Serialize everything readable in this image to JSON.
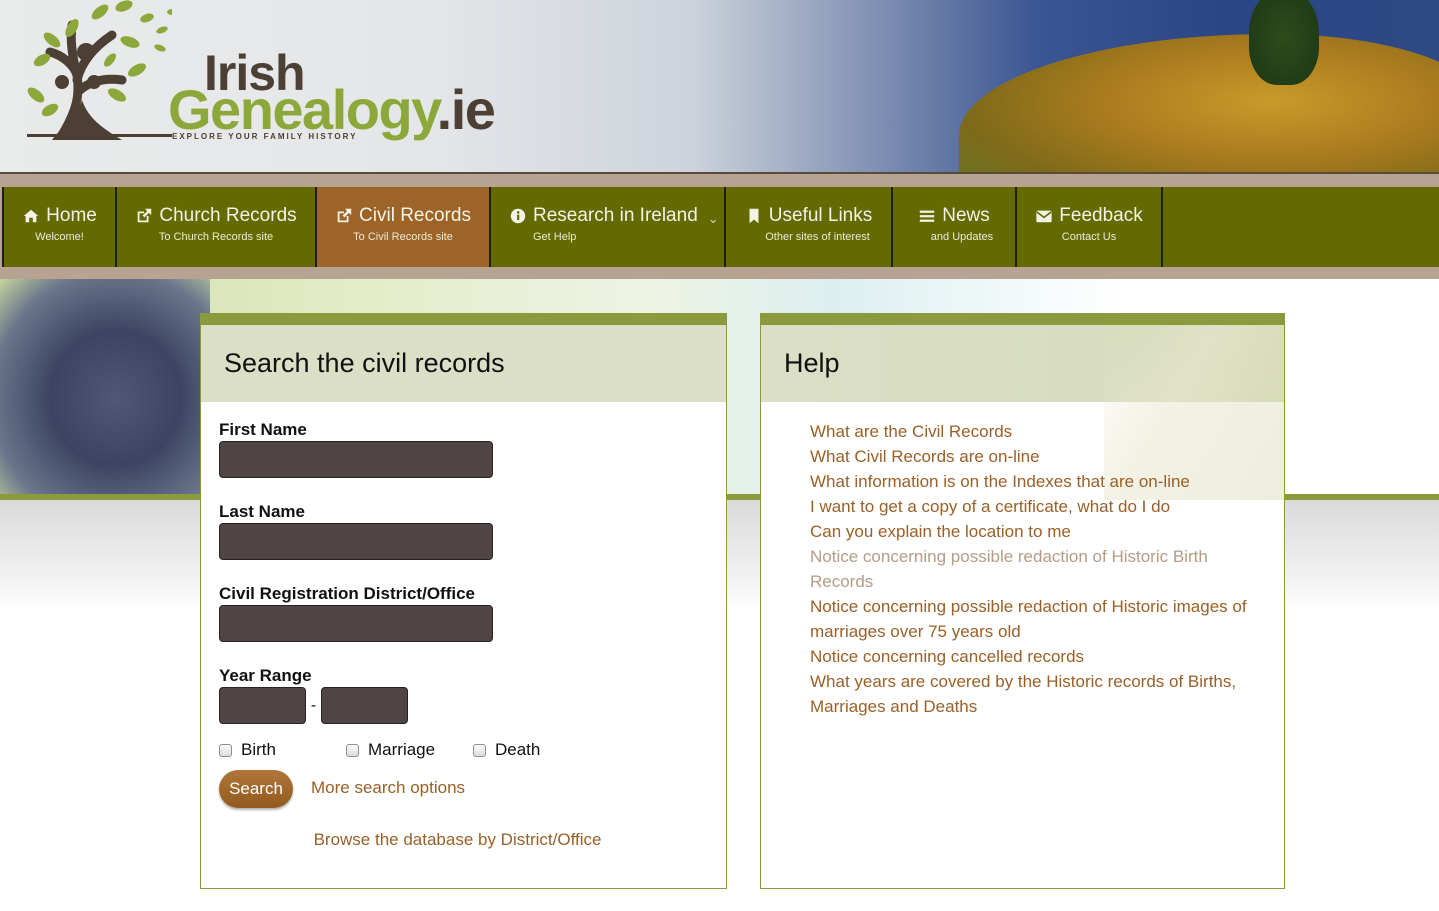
{
  "site": {
    "logo_line1": "Irish",
    "logo_line2": "Genealogy",
    "logo_suffix": ".ie",
    "tagline": "EXPLORE YOUR FAMILY HISTORY"
  },
  "nav": {
    "items": [
      {
        "label": "Home",
        "sub": "Welcome!",
        "icon": "home-icon"
      },
      {
        "label": "Church Records",
        "sub": "To Church Records site",
        "icon": "external-link-icon"
      },
      {
        "label": "Civil Records",
        "sub": "To Civil Records site",
        "icon": "external-link-icon",
        "active": true
      },
      {
        "label": "Research in Ireland",
        "sub": "Get Help",
        "icon": "info-icon",
        "dropdown": "chevron-down-icon"
      },
      {
        "label": "Useful Links",
        "sub": "Other sites of interest",
        "icon": "bookmark-icon"
      },
      {
        "label": "News",
        "sub": "and Updates",
        "icon": "menu-icon"
      },
      {
        "label": "Feedback",
        "sub": "Contact Us",
        "icon": "envelope-icon"
      }
    ],
    "chevron": "⌄"
  },
  "search": {
    "title": "Search the civil records",
    "first_name_label": "First Name",
    "first_name_value": "",
    "last_name_label": "Last Name",
    "last_name_value": "",
    "district_label": "Civil Registration District/Office",
    "district_value": "",
    "year_range_label": "Year Range",
    "year_from_value": "",
    "year_to_value": "",
    "year_separator": "-",
    "checkboxes": [
      {
        "label": "Birth",
        "checked": false
      },
      {
        "label": "Marriage",
        "checked": false
      },
      {
        "label": "Death",
        "checked": false
      }
    ],
    "search_button": "Search",
    "more_options_link": "More search options",
    "browse_link": "Browse the database by District/Office"
  },
  "help": {
    "title": "Help",
    "links": [
      {
        "text": "What are the Civil Records",
        "visited": false
      },
      {
        "text": "What Civil Records are on-line",
        "visited": false
      },
      {
        "text": "What information is on the Indexes that are on-line",
        "visited": false
      },
      {
        "text": "I want to get a copy of a certificate, what do I do",
        "visited": false
      },
      {
        "text": "Can you explain the location to me",
        "visited": false
      },
      {
        "text": "Notice concerning possible redaction of Historic Birth Records",
        "visited": true
      },
      {
        "text": "Notice concerning possible redaction of Historic images of marriages over 75 years old",
        "visited": false
      },
      {
        "text": "Notice concerning cancelled records",
        "visited": false
      },
      {
        "text": "What years are covered by the Historic records of Births, Marriages and Deaths",
        "visited": false
      }
    ]
  },
  "colors": {
    "nav_bg": "#626a00",
    "nav_active": "#9c6426",
    "panel_accent": "#8a9a3c",
    "link": "#9a6028",
    "link_visited": "#b49c86",
    "input_bg": "#504545"
  }
}
